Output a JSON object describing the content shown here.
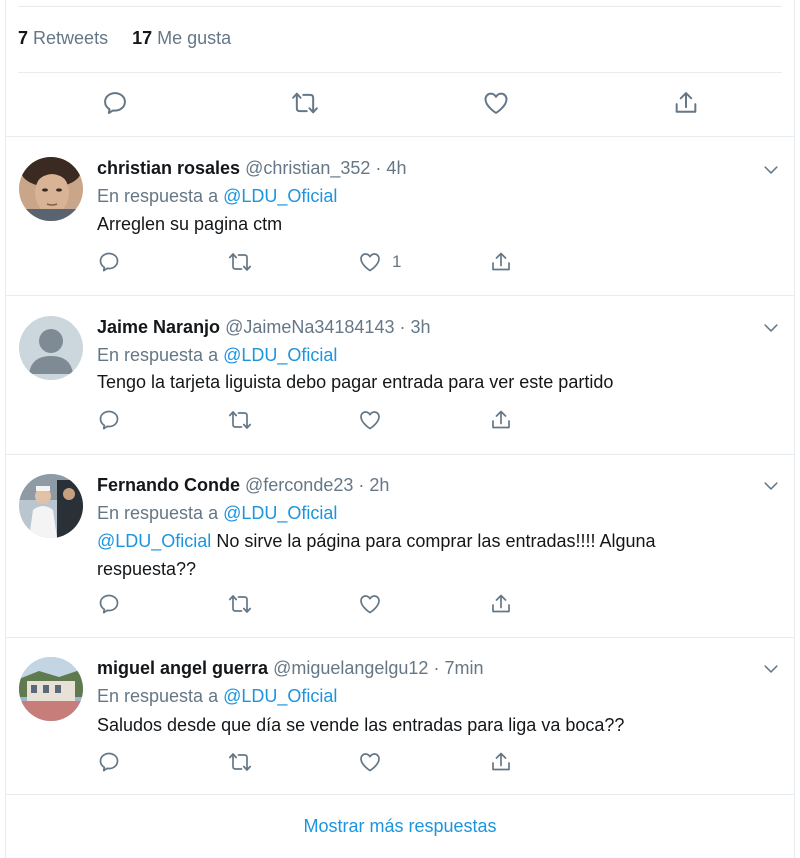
{
  "stats": {
    "retweets_count": "7",
    "retweets_label": "Retweets",
    "likes_count": "17",
    "likes_label": "Me gusta"
  },
  "reply_prefix": "En respuesta a",
  "replies": [
    {
      "name": "christian rosales",
      "meta": "@christian_352 · 4h",
      "reply_to": "@LDU_Oficial",
      "text": "Arreglen su pagina ctm",
      "like_count": "1"
    },
    {
      "name": "Jaime Naranjo",
      "meta": "@JaimeNa34184143 · 3h",
      "reply_to": "@LDU_Oficial",
      "text": "Tengo la tarjeta liguista debo pagar entrada para ver este partido",
      "like_count": ""
    },
    {
      "name": "Fernando Conde",
      "meta": "@ferconde23 · 2h",
      "reply_to": "@LDU_Oficial",
      "mention": "@LDU_Oficial",
      "text_line1": " No sirve la página para comprar las entradas!!!! Alguna",
      "text_line2": "respuesta??",
      "like_count": ""
    },
    {
      "name": "miguel angel guerra",
      "meta": "@miguelangelgu12 · 7min",
      "reply_to": "@LDU_Oficial",
      "text": "Saludos desde que día se vende las entradas para liga va boca??",
      "like_count": ""
    }
  ],
  "show_more": "Mostrar más respuestas",
  "colors": {
    "accent": "#1b95e0",
    "secondary": "#657786",
    "divider": "#e6ecf0"
  },
  "icons": [
    "reply-icon",
    "retweet-icon",
    "like-icon",
    "share-icon",
    "chevron-down-icon"
  ]
}
